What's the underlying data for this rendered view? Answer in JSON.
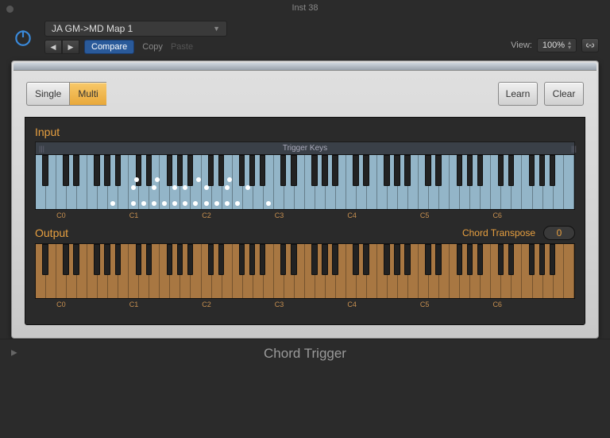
{
  "window": {
    "title": "Inst 38"
  },
  "toolbar": {
    "preset": "JA GM->MD Map 1",
    "compare": "Compare",
    "copy": "Copy",
    "paste": "Paste",
    "view_label": "View:",
    "zoom": "100%"
  },
  "modes": {
    "single": "Single",
    "multi": "Multi",
    "active": "multi"
  },
  "actions": {
    "learn": "Learn",
    "clear": "Clear"
  },
  "input": {
    "label": "Input",
    "trigger_label": "Trigger Keys",
    "note_labels": [
      "C0",
      "C1",
      "C2",
      "C3",
      "C4",
      "C5",
      "C6"
    ],
    "trigger_dots": {
      "lower_white": [
        7,
        9,
        10,
        11,
        12,
        13,
        14,
        15,
        16,
        17,
        18,
        19,
        22
      ],
      "upper_white": [
        9,
        11,
        13,
        14,
        16,
        18,
        20
      ],
      "upper_black_after_white": [
        9,
        11,
        15,
        18
      ]
    }
  },
  "output": {
    "label": "Output",
    "transpose_label": "Chord Transpose",
    "transpose_value": "0",
    "note_labels": [
      "C0",
      "C1",
      "C2",
      "C3",
      "C4",
      "C5",
      "C6"
    ]
  },
  "footer": {
    "name": "Chord Trigger"
  },
  "keyboard": {
    "white_count": 52,
    "black_pattern": [
      1,
      1,
      0,
      1,
      1,
      1,
      0
    ]
  }
}
